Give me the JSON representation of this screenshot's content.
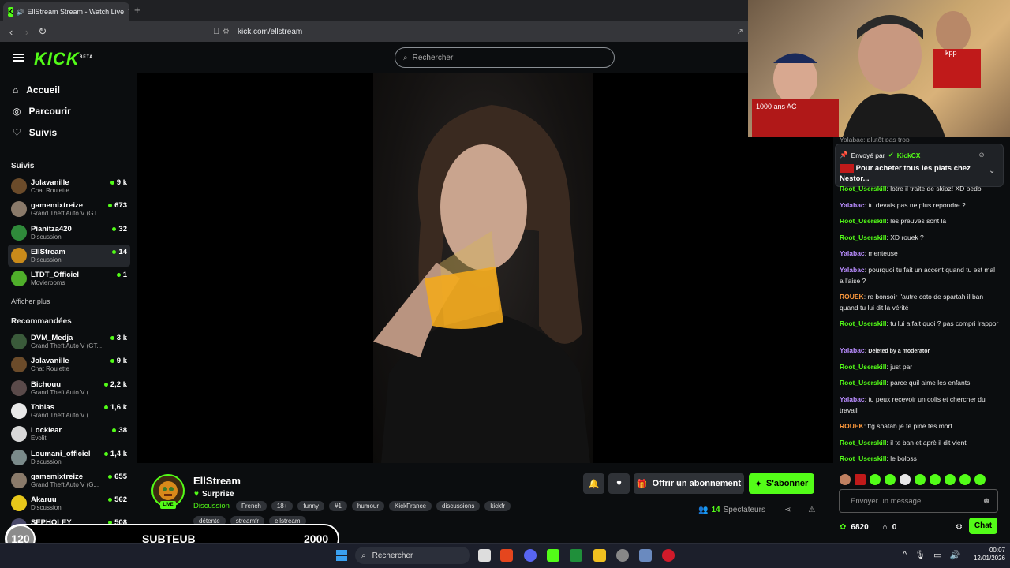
{
  "browser": {
    "tab_title": "EllStream Stream - Watch Live",
    "url": "kick.com/ellstream",
    "new_tab": "+",
    "close": "✕"
  },
  "header": {
    "logo": "KICK",
    "logo_badge": "BETA",
    "search_placeholder": "Rechercher"
  },
  "nav": [
    {
      "label": "Accueil",
      "icon": "home-icon"
    },
    {
      "label": "Parcourir",
      "icon": "compass-icon"
    },
    {
      "label": "Suivis",
      "icon": "heart-icon"
    }
  ],
  "followed": {
    "title": "Suivis",
    "channels": [
      {
        "name": "Jolavanille",
        "category": "Chat Roulette",
        "viewers": "9 k",
        "color": "#6b4b2a"
      },
      {
        "name": "gamemixtreize",
        "category": "Grand Theft Auto V (GT...",
        "viewers": "673",
        "color": "#8a7a6a"
      },
      {
        "name": "Pianitza420",
        "category": "Discussion",
        "viewers": "32",
        "color": "#2f8a3a"
      },
      {
        "name": "EllStream",
        "category": "Discussion",
        "viewers": "14",
        "color": "#c98a1a"
      },
      {
        "name": "LTDT_Officiel",
        "category": "Movierooms",
        "viewers": "1",
        "color": "#4fae2a"
      }
    ],
    "show_more": "Afficher plus"
  },
  "recommended": {
    "title": "Recommandées",
    "channels": [
      {
        "name": "DVM_Medja",
        "category": "Grand Theft Auto V (GT...",
        "viewers": "3 k",
        "color": "#3a5a3a"
      },
      {
        "name": "Jolavanille",
        "category": "Chat Roulette",
        "viewers": "9 k",
        "color": "#6b4b2a"
      },
      {
        "name": "Bichouu",
        "category": "Grand Theft Auto V (...",
        "viewers": "2,2 k",
        "color": "#5a4a4a"
      },
      {
        "name": "Tobias",
        "category": "Grand Theft Auto V (...",
        "viewers": "1,6 k",
        "color": "#e8e8e8"
      },
      {
        "name": "Locklear",
        "category": "Evolit",
        "viewers": "38",
        "color": "#d8d8d8"
      },
      {
        "name": "Loumani_officiel",
        "category": "Discussion",
        "viewers": "1,4 k",
        "color": "#7a8a8a"
      },
      {
        "name": "gamemixtreize",
        "category": "Grand Theft Auto V (G...",
        "viewers": "655",
        "color": "#8a7a6a"
      },
      {
        "name": "Akaruu",
        "category": "Discussion",
        "viewers": "562",
        "color": "#e8c81a"
      },
      {
        "name": "SEPHOLEY",
        "category": "Grand Theft Auto V (G...",
        "viewers": "508",
        "color": "#4a4a6a"
      }
    ]
  },
  "stream": {
    "name": "EllStream",
    "title": "Surprise",
    "live": "LIVE",
    "category": "Discussion",
    "tags": [
      "French",
      "18+",
      "funny",
      "#1",
      "humour",
      "KickFrance",
      "discussions",
      "kickfr",
      "détente",
      "streamfr",
      "ellstream"
    ],
    "gift_label": "Offrir un abonnement",
    "sub_label": "S'abonner",
    "viewers": "14",
    "viewers_label": "Spectateurs"
  },
  "overlay": {
    "count": "120",
    "label": "SUBTEUB",
    "goal": "2000"
  },
  "webcam": {
    "text_1": "1000 ans AC",
    "text_2": "kpp"
  },
  "chat": {
    "cut_line": "Yalabac: plutôt pas trop",
    "pinned": {
      "sent_by": "Envoyé par",
      "user": "KickCX",
      "text": "Pour acheter tous les plats chez Nestor..."
    },
    "messages": [
      {
        "user": "Root_Userskill",
        "color": "g",
        "text": "lotre il traite de skipz! XD pedo"
      },
      {
        "user": "Yalabac",
        "color": "p",
        "text": "tu devais pas ne plus repondre ?"
      },
      {
        "user": "Root_Userskill",
        "color": "g",
        "text": "les preuves sont là"
      },
      {
        "user": "Root_Userskill",
        "color": "g",
        "text": "XD rouek ?"
      },
      {
        "user": "Yalabac",
        "color": "p",
        "text": "menteuse"
      },
      {
        "user": "Yalabac",
        "color": "p",
        "text": "pourquoi tu fait un accent quand tu est mal a l'aise ?"
      },
      {
        "user": "ROUEK",
        "color": "o",
        "text": "re bonsoir l'autre coto de spartah il ban quand tu lui dit la vérité"
      },
      {
        "user": "Root_Userskill",
        "color": "g",
        "text": "tu lui a fait quoi ? pas compri lrappor"
      },
      {
        "user": "Yalabac",
        "color": "p",
        "text": "Deleted by a moderator"
      },
      {
        "user": "Root_Userskill",
        "color": "g",
        "text": "just par"
      },
      {
        "user": "Root_Userskill",
        "color": "g",
        "text": "parce quil aime les enfants"
      },
      {
        "user": "Yalabac",
        "color": "p",
        "text": "tu peux recevoir un colis et chercher du travail"
      },
      {
        "user": "ROUEK",
        "color": "o",
        "text": "ftg spatah je te pine tes mort"
      },
      {
        "user": "Root_Userskill",
        "color": "g",
        "text": "il te ban et aprè il dit vient"
      },
      {
        "user": "Root_Userskill",
        "color": "g",
        "text": "le boloss"
      }
    ],
    "input_placeholder": "Envoyer un message",
    "points": "6820",
    "second_count": "0",
    "send_label": "Chat"
  },
  "taskbar": {
    "search": "Rechercher",
    "time": "00:07",
    "date": "12/01/2026"
  },
  "colors": {
    "accent": "#53fc18",
    "bg": "#0b0d0f",
    "panel": "#2f3237"
  }
}
